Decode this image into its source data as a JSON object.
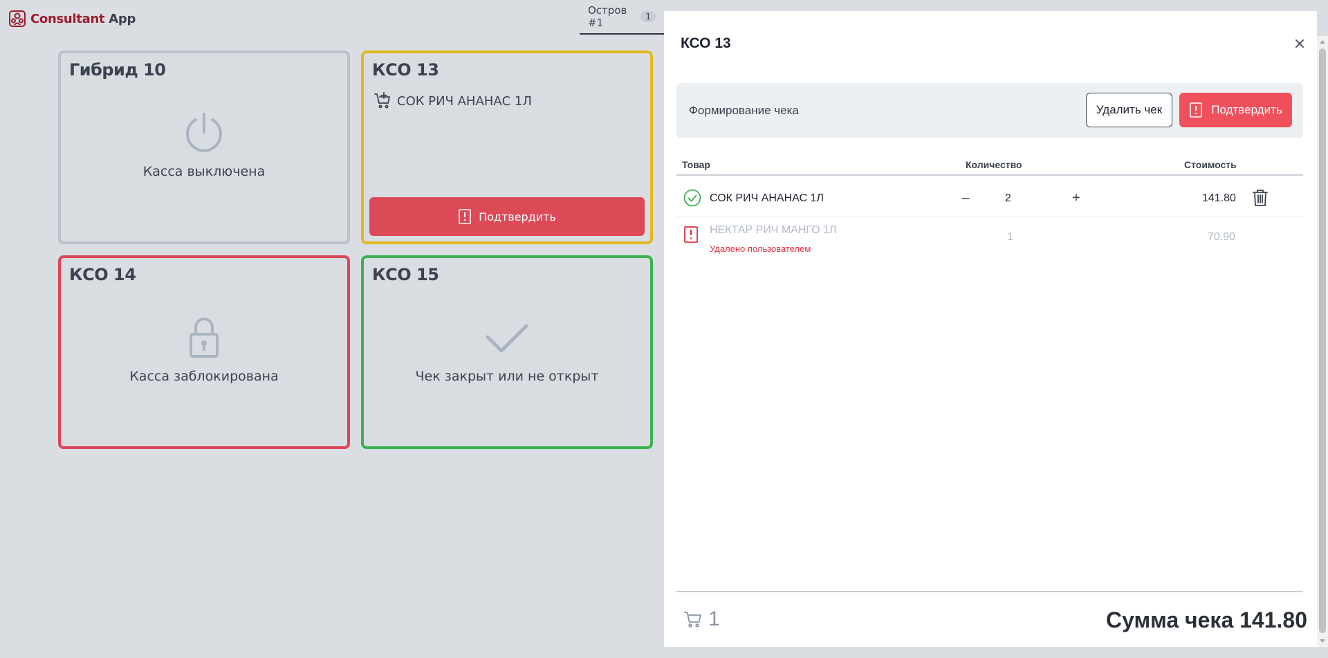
{
  "header": {
    "brand": "Consultant",
    "app": "App",
    "tab": {
      "label": "Остров #1",
      "badge": "1"
    }
  },
  "tiles": [
    {
      "title": "Гибрид 10",
      "status": "Касса выключена",
      "icon": "power-icon",
      "color": "#b8c1cc"
    },
    {
      "title": "КСО 13",
      "item": "СОК РИЧ АНАНАС 1Л",
      "button": "Подтвердить",
      "icon": "cart-add-icon",
      "color": "#e2b820"
    },
    {
      "title": "КСО 14",
      "status": "Касса заблокирована",
      "icon": "lock-icon",
      "color": "#dd4455"
    },
    {
      "title": "КСО 15",
      "status": "Чек закрыт или не открыт",
      "icon": "check-icon",
      "color": "#3bb14f"
    }
  ],
  "panel": {
    "title": "КСО 13",
    "action_label": "Формирование чека",
    "delete_button": "Удалить чек",
    "confirm_button": "Подтвердить",
    "columns": {
      "product": "Товар",
      "quantity": "Количество",
      "price": "Стоимость"
    },
    "rows": [
      {
        "name": "СОК РИЧ АНАНАС 1Л",
        "qty": "2",
        "price": "141.80",
        "status": "confirmed"
      },
      {
        "name": "НЕКТАР РИЧ МАНГО 1Л",
        "qty": "1",
        "price": "70.90",
        "status": "deleted",
        "note": "Удалено пользователем"
      }
    ],
    "cart_count": "1",
    "total_label": "Сумма чека 141.80"
  },
  "colors": {
    "accent_red": "#f0505c",
    "brand": "#a01a2a",
    "success": "#3bb14f",
    "warning": "#e2b820"
  }
}
